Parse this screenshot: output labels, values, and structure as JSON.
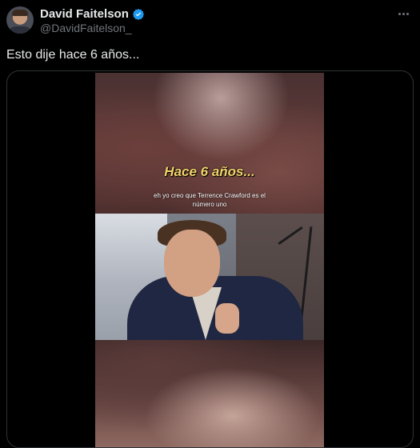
{
  "author": {
    "display_name": "David Faitelson",
    "handle": "@DavidFaitelson_",
    "verified_icon": "verified-badge-icon",
    "verified_color": "#1d9bf0"
  },
  "post": {
    "text": "Esto dije hace 6 años..."
  },
  "video": {
    "caption_title": "Hace 6 años...",
    "caption_line1": "eh yo creo que Terrence Crawford es el",
    "caption_line2": "número uno"
  },
  "icons": {
    "more": "more-options-icon"
  }
}
